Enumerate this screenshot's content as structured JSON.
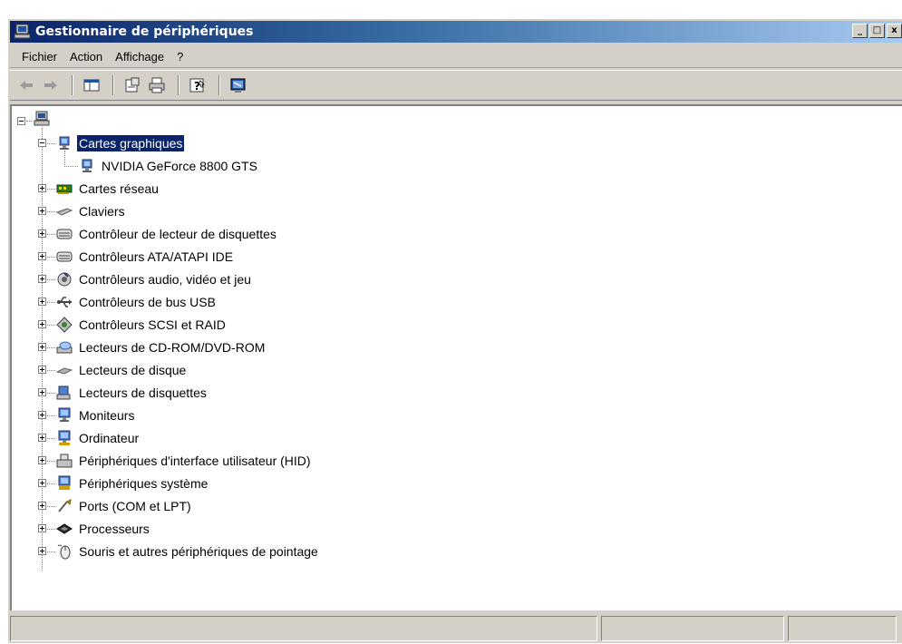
{
  "window": {
    "title": "Gestionnaire de périphériques",
    "controls": {
      "minimize": "_",
      "maximize": "□",
      "close": "x"
    }
  },
  "menu": {
    "items": [
      "Fichier",
      "Action",
      "Affichage",
      "?"
    ]
  },
  "toolbar": {
    "buttons": [
      "back-arrow-icon",
      "forward-arrow-icon",
      "show-hide-console-tree-icon",
      "properties-icon",
      "print-icon",
      "help-icon",
      "scan-hardware-icon"
    ]
  },
  "tree": {
    "root_icon": "computer-icon",
    "selected": "Cartes graphiques",
    "expanded_category": {
      "label": "Cartes graphiques",
      "icon": "display-adapter-icon",
      "children": [
        {
          "label": "NVIDIA GeForce 8800 GTS",
          "icon": "display-adapter-icon"
        }
      ]
    },
    "categories": [
      {
        "label": "Cartes réseau",
        "icon": "network-card-icon"
      },
      {
        "label": "Claviers",
        "icon": "keyboard-icon"
      },
      {
        "label": "Contrôleur de lecteur de disquettes",
        "icon": "floppy-controller-icon"
      },
      {
        "label": "Contrôleurs ATA/ATAPI IDE",
        "icon": "ide-controller-icon"
      },
      {
        "label": "Contrôleurs audio, vidéo et jeu",
        "icon": "audio-icon"
      },
      {
        "label": "Contrôleurs de bus USB",
        "icon": "usb-icon"
      },
      {
        "label": "Contrôleurs SCSI et RAID",
        "icon": "scsi-icon"
      },
      {
        "label": "Lecteurs de CD-ROM/DVD-ROM",
        "icon": "cdrom-icon"
      },
      {
        "label": "Lecteurs de disque",
        "icon": "disk-drive-icon"
      },
      {
        "label": "Lecteurs de disquettes",
        "icon": "floppy-drive-icon"
      },
      {
        "label": "Moniteurs",
        "icon": "monitor-icon"
      },
      {
        "label": "Ordinateur",
        "icon": "computer-icon"
      },
      {
        "label": "Périphériques d'interface utilisateur (HID)",
        "icon": "hid-icon"
      },
      {
        "label": "Périphériques système",
        "icon": "system-device-icon"
      },
      {
        "label": "Ports (COM et LPT)",
        "icon": "port-icon"
      },
      {
        "label": "Processeurs",
        "icon": "processor-icon"
      },
      {
        "label": "Souris et autres périphériques de pointage",
        "icon": "mouse-icon"
      }
    ]
  },
  "colors": {
    "title_gradient_start": "#0a246a",
    "title_gradient_end": "#a6caf0",
    "chrome": "#d4d0c8",
    "selection": "#0a246a"
  }
}
